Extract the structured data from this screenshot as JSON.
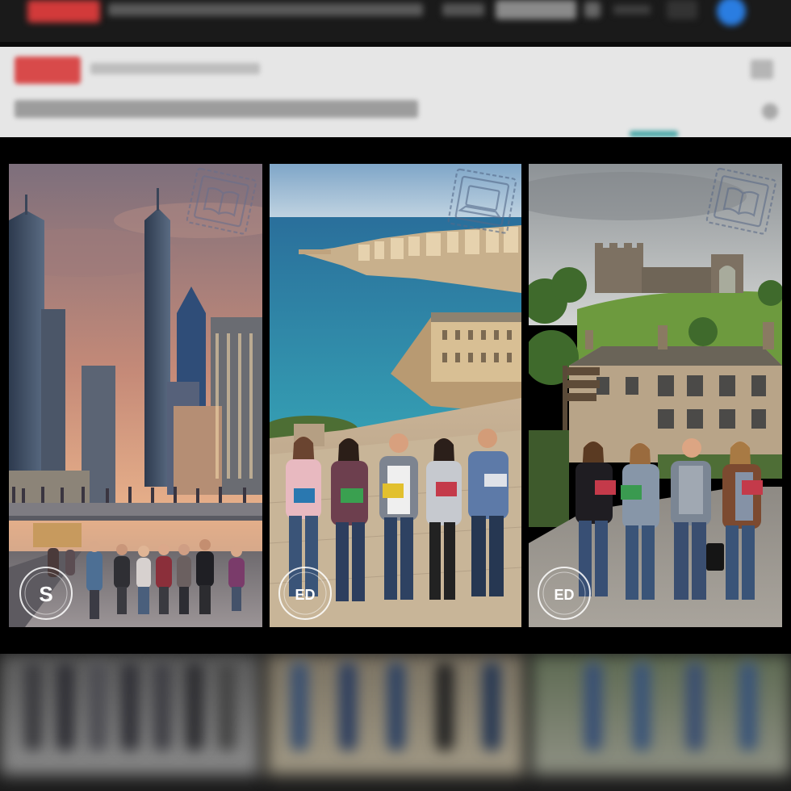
{
  "gallery": {
    "panels": [
      {
        "theme": "city-skyline",
        "badge_icon": "book-stamp-icon",
        "logo_text": "S"
      },
      {
        "theme": "coastal-city",
        "badge_icon": "laptop-stamp-icon",
        "logo_text": "ED"
      },
      {
        "theme": "countryside-castle",
        "badge_icon": "book-stamp-icon",
        "logo_text": "ED"
      }
    ]
  },
  "colors": {
    "topbar": "#1a1a1a",
    "accent_red": "#d23a3a",
    "accent_blue": "#2a7de1",
    "subbar": "#e6e6e6"
  }
}
